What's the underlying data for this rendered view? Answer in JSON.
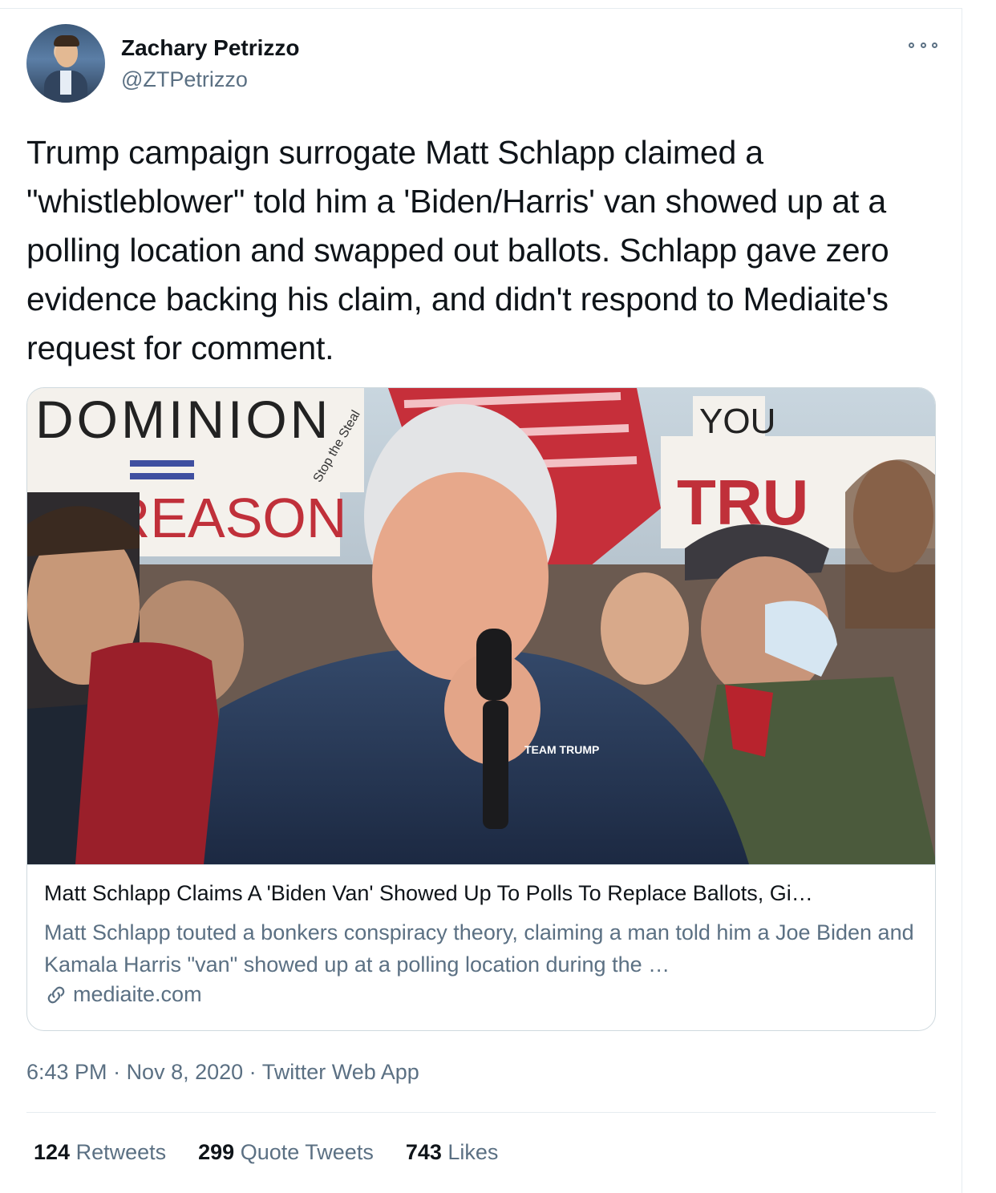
{
  "user": {
    "name": "Zachary Petrizzo",
    "handle": "@ZTPetrizzo"
  },
  "tweet": {
    "text": "Trump campaign surrogate Matt Schlapp claimed a \"whistleblower\" told him a 'Biden/Harris' van showed up at a polling location and swapped out ballots. Schlapp gave zero evidence backing his claim, and didn't respond to Mediaite's request for comment."
  },
  "card": {
    "image_texts": {
      "sign_dominion": "DOMINION",
      "sign_treason": "TREASON",
      "sign_stop": "Stop the Steal",
      "sign_you": "YOU",
      "sign_trump": "TRU",
      "jacket_logo": "TEAM TRUMP"
    },
    "title": "Matt Schlapp Claims A 'Biden Van' Showed Up To Polls To Replace Ballots, Gi…",
    "description": "Matt Schlapp touted a bonkers conspiracy theory, claiming a man told him a Joe Biden and Kamala Harris \"van\" showed up at a polling location during the …",
    "domain": "mediaite.com"
  },
  "meta": {
    "time": "6:43 PM",
    "sep1": " · ",
    "date": "Nov 8, 2020",
    "sep2": " · ",
    "app": "Twitter Web App"
  },
  "stats": {
    "retweets_count": "124",
    "retweets_label": "Retweets",
    "quotes_count": "299",
    "quotes_label": "Quote Tweets",
    "likes_count": "743",
    "likes_label": "Likes"
  },
  "colors": {
    "text": "#0f1419",
    "secondary": "#5b7083",
    "border": "#cfd9de"
  },
  "icons": [
    "more-icon",
    "link-icon"
  ]
}
